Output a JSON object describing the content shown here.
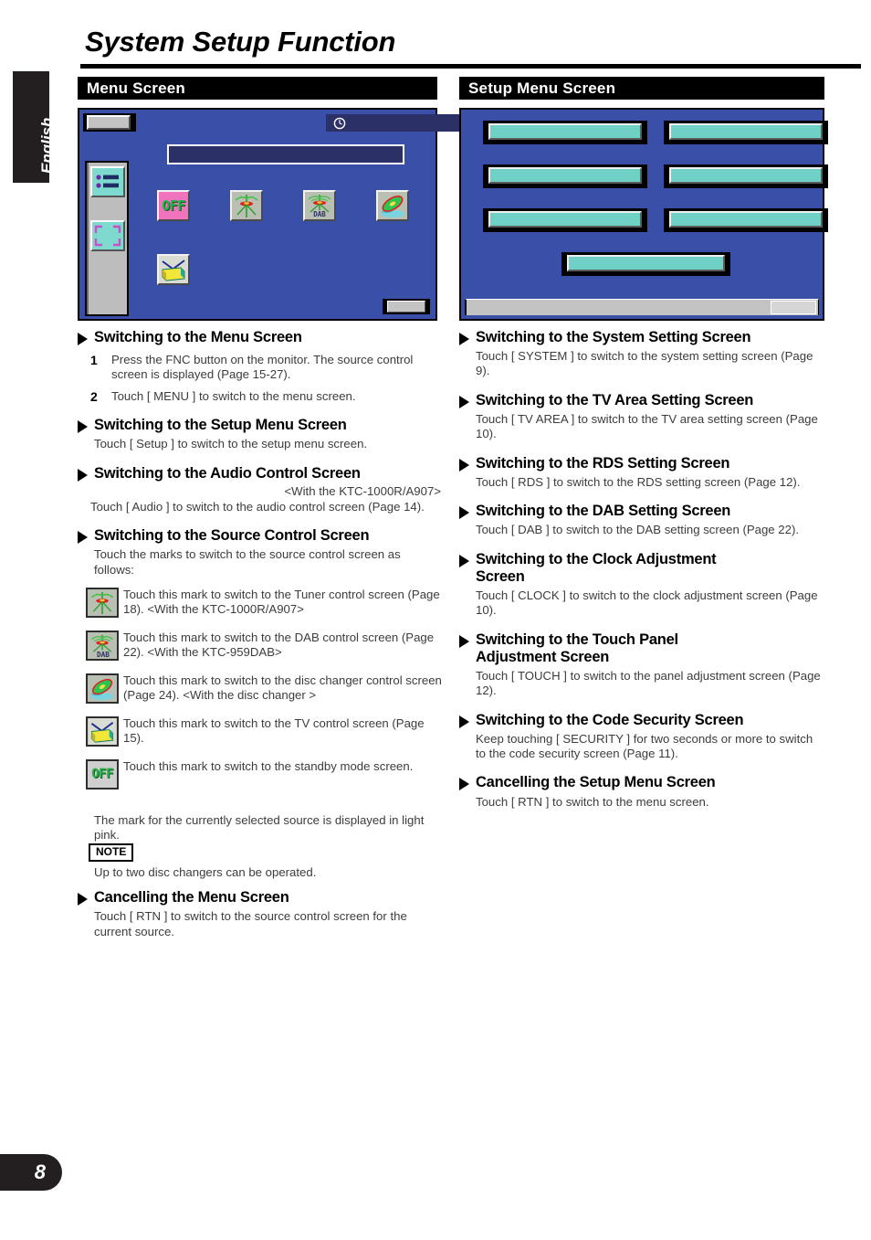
{
  "page": {
    "title": "System Setup Function",
    "language_tab": "English",
    "page_number": "8"
  },
  "sections": {
    "left_header": "Menu Screen",
    "right_header": "Setup Menu Screen"
  },
  "mockups": {
    "menu_screen": {
      "icons": [
        {
          "name": "off-icon",
          "label": "OFF",
          "highlight_color": "#ef74bd"
        },
        {
          "name": "tuner-icon",
          "label": ""
        },
        {
          "name": "dab-icon",
          "label": "DAB"
        },
        {
          "name": "disc-changer-icon",
          "label": ""
        },
        {
          "name": "tv-icon",
          "label": ""
        }
      ],
      "sidebar_icons": [
        "menu-list-icon",
        "expand-icon"
      ],
      "clock_icon": "clock-icon"
    },
    "setup_menu_screen": {
      "button_count": 7
    }
  },
  "left_column": {
    "h1": "Switching to the Menu Screen",
    "step1_num": "1",
    "step1_text": "Press the FNC button on the monitor. The source control screen is displayed (Page 15-27).",
    "step2_num": "2",
    "step2_text": "Touch [ MENU ] to switch to the menu screen.",
    "h2": "Switching to the Setup Menu Screen",
    "p2": "Touch [ Setup ] to switch to the setup menu screen.",
    "h3": "Switching to the Audio Control Screen",
    "p3_note": "<With the KTC-1000R/A907>",
    "p3": "Touch [ Audio ] to switch to the audio control screen (Page 14).",
    "h4": "Switching to the Source Control Screen",
    "p4": "Touch the marks to switch to the source control screen as follows:",
    "marks": [
      {
        "icon": "tuner-icon",
        "text": "Touch this mark to switch to the Tuner control screen (Page 18). <With the KTC-1000R/A907>"
      },
      {
        "icon": "dab-icon",
        "text": "Touch this mark to switch to the DAB control screen (Page 22). <With the KTC-959DAB>"
      },
      {
        "icon": "disc-changer-icon",
        "text": "Touch this mark to switch to the disc changer control screen (Page 24). <With the disc changer >"
      },
      {
        "icon": "tv-icon",
        "text": "Touch this mark to switch to the TV control screen (Page 15)."
      },
      {
        "icon": "off-icon",
        "text": "Touch this mark to switch to the standby mode screen."
      }
    ],
    "pink_note": "The mark for the currently selected source is displayed in light pink.",
    "note_label": "NOTE",
    "note_text": "Up to two disc changers can be operated.",
    "h5": "Cancelling the Menu Screen",
    "p5": "Touch [ RTN ] to switch to the source control screen for the current source."
  },
  "right_column": {
    "h1": "Switching to the System Setting Screen",
    "p1": "Touch [ SYSTEM ] to switch to the system setting screen (Page 9).",
    "h2": "Switching to the TV Area Setting Screen",
    "p2": "Touch [ TV AREA ] to switch to the TV area setting screen (Page 10).",
    "h3": "Switching to the RDS Setting Screen",
    "p3": "Touch [ RDS ] to switch to the RDS setting screen (Page 12).",
    "h4": "Switching to the DAB Setting Screen",
    "p4": "Touch [ DAB ] to switch to the DAB setting screen (Page 22).",
    "h5_line1": "Switching to the Clock Adjustment",
    "h5_line2": "Screen",
    "p5": "Touch [ CLOCK ] to switch to the clock adjustment screen (Page 10).",
    "h6_line1": "Switching to the Touch Panel",
    "h6_line2": "Adjustment Screen",
    "p6": "Touch [ TOUCH ] to switch to the panel adjustment screen (Page 12).",
    "h7": "Switching to the Code Security Screen",
    "p7": "Keep touching [ SECURITY ] for two seconds or more to switch to the code security screen (Page 11).",
    "h8": "Cancelling the Setup Menu Screen",
    "p8": "Touch [ RTN ] to switch to the menu screen."
  },
  "colors": {
    "screen_blue": "#3a50a8",
    "button_teal": "#6fd0c5",
    "highlight_pink": "#ef74bd",
    "off_green": "#27b34a",
    "header_black": "#000000"
  }
}
